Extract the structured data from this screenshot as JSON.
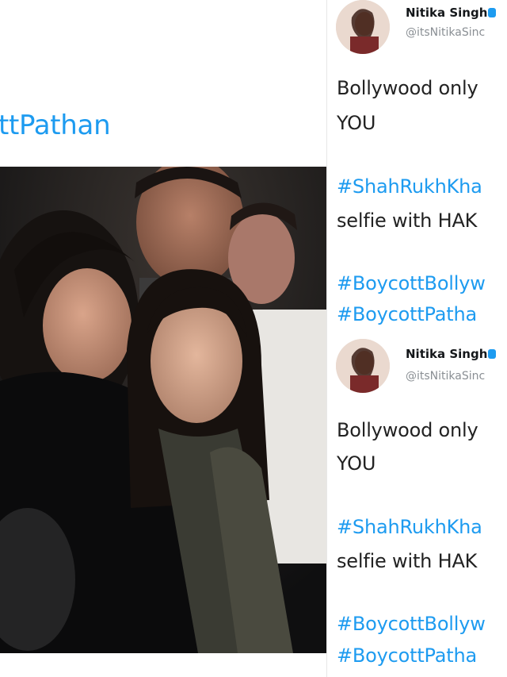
{
  "left": {
    "hashtag": "ttPathan",
    "photo_alt": "crowd photo"
  },
  "tweets": [
    {
      "author": "Nitika Singh",
      "handle": "@itsNitikaSinc",
      "lines": [
        "Bollywood only",
        "YOU",
        "#ShahRukhKha",
        "selfie with HAK",
        "#BoycottBollyw",
        "#BoycottPatha"
      ]
    },
    {
      "author": "Nitika Singh",
      "handle": "@itsNitikaSinc",
      "lines": [
        "Bollywood only",
        "YOU",
        "#ShahRukhKha",
        "selfie with HAK",
        "#BoycottBollyw",
        "#BoycottPatha"
      ]
    }
  ],
  "colors": {
    "hashtag": "#1d9bf0",
    "text": "#222222",
    "handle": "#8a8f94"
  }
}
